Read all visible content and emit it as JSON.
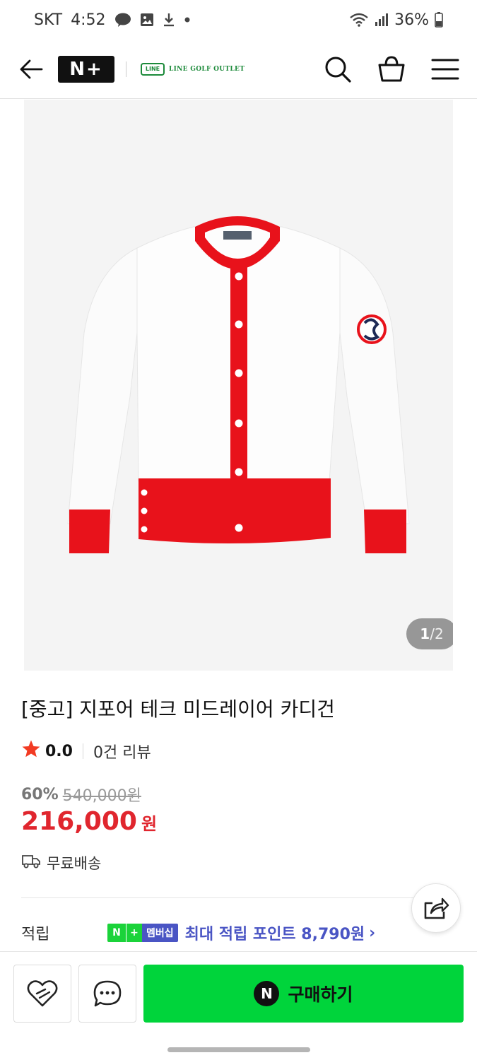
{
  "status_bar": {
    "carrier": "SKT",
    "time": "4:52",
    "battery": "36%",
    "icons": [
      "talk-icon",
      "gallery-icon",
      "download-icon",
      "dot-icon",
      "wifi-icon",
      "signal-icon",
      "battery-icon"
    ]
  },
  "header": {
    "logo": "N+",
    "brand_badge": "LINE",
    "brand_name": "LINE GOLF OUTLET",
    "icons": [
      "back-arrow-icon",
      "search-icon",
      "basket-icon",
      "menu-icon"
    ]
  },
  "gallery": {
    "current": "1",
    "separator": "/",
    "total": "2"
  },
  "product": {
    "title": "[중고] 지포어 테크 미드레이어 카디건",
    "rating": "0.0",
    "reviews": "0건 리뷰",
    "discount": "60%",
    "original_price": "540,000원",
    "price": "216,000",
    "currency": "원",
    "shipping": "무료배송"
  },
  "points": {
    "label": "적립",
    "badge_n": "N",
    "badge_plus": "+",
    "badge_member": "멤버십",
    "text": "최대 적립 포인트 8,790원",
    "chevron": "›"
  },
  "bottom_bar": {
    "buy_mark": "N",
    "buy_label": "구매하기"
  },
  "colors": {
    "accent_green": "#00d43b",
    "price_red": "#e0262e",
    "membership_blue": "#4a55c4",
    "brand_green": "#1c8a3a"
  }
}
